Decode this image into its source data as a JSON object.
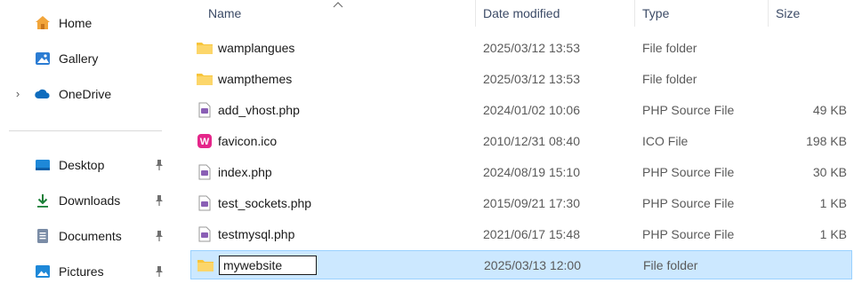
{
  "sidebar": {
    "items": [
      {
        "label": "Home",
        "icon": "home-icon"
      },
      {
        "label": "Gallery",
        "icon": "gallery-icon"
      },
      {
        "label": "OneDrive",
        "icon": "onedrive-icon",
        "expandable": true
      },
      {
        "label": "Desktop",
        "icon": "desktop-icon",
        "pinned": true
      },
      {
        "label": "Downloads",
        "icon": "downloads-icon",
        "pinned": true
      },
      {
        "label": "Documents",
        "icon": "documents-icon",
        "pinned": true
      },
      {
        "label": "Pictures",
        "icon": "pictures-icon",
        "pinned": true
      }
    ]
  },
  "columns": {
    "name": "Name",
    "date": "Date modified",
    "type": "Type",
    "size": "Size"
  },
  "files": [
    {
      "name": "wamplangues",
      "date": "2025/03/12 13:53",
      "type": "File folder",
      "size": "",
      "icon": "folder-icon"
    },
    {
      "name": "wampthemes",
      "date": "2025/03/12 13:53",
      "type": "File folder",
      "size": "",
      "icon": "folder-icon"
    },
    {
      "name": "add_vhost.php",
      "date": "2024/01/02 10:06",
      "type": "PHP Source File",
      "size": "49 KB",
      "icon": "php-file-icon"
    },
    {
      "name": "favicon.ico",
      "date": "2010/12/31 08:40",
      "type": "ICO File",
      "size": "198 KB",
      "icon": "wamp-favicon-icon"
    },
    {
      "name": "index.php",
      "date": "2024/08/19 15:10",
      "type": "PHP Source File",
      "size": "30 KB",
      "icon": "php-file-icon"
    },
    {
      "name": "test_sockets.php",
      "date": "2015/09/21 17:30",
      "type": "PHP Source File",
      "size": "1 KB",
      "icon": "php-file-icon"
    },
    {
      "name": "testmysql.php",
      "date": "2021/06/17 15:48",
      "type": "PHP Source File",
      "size": "1 KB",
      "icon": "php-file-icon"
    }
  ],
  "renaming": {
    "value": "mywebsite",
    "date": "2025/03/13 12:00",
    "type": "File folder",
    "size": ""
  },
  "colors": {
    "selected_bg": "#cce8ff",
    "selected_border": "#99d1ff",
    "folder_yellow": "#f8c53a",
    "header_text": "#3b4a66"
  }
}
